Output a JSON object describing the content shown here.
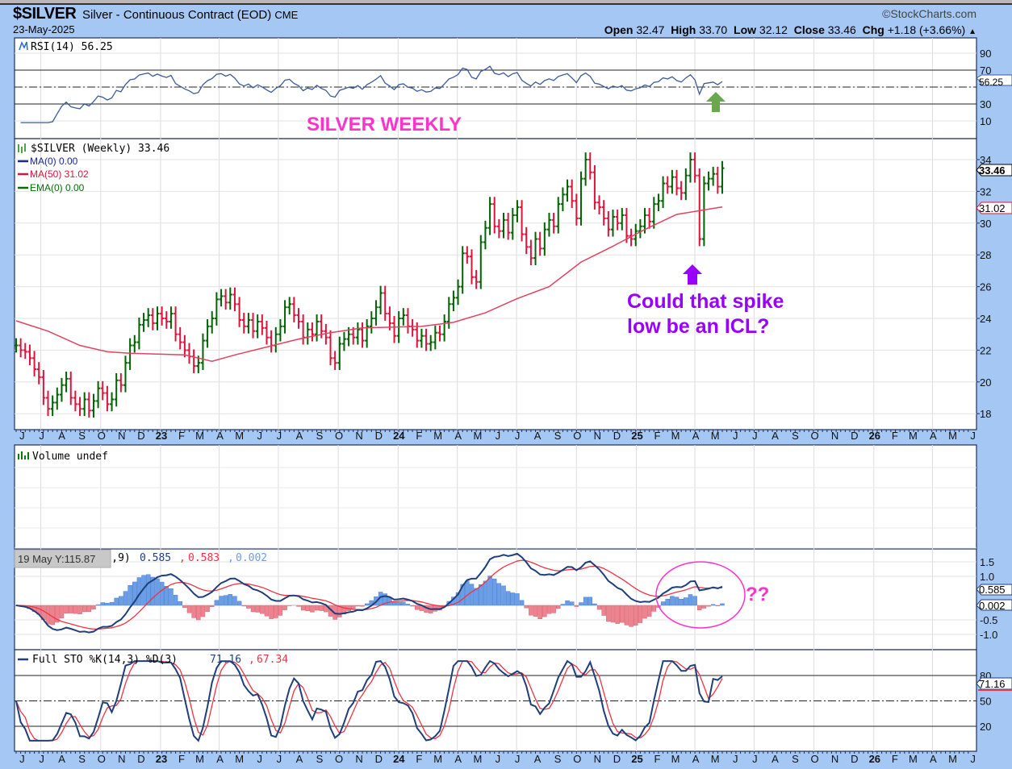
{
  "header": {
    "symbol": "$SILVER",
    "description": "Silver - Continuous Contract (EOD)",
    "exchange": "CME",
    "date": "23-May-2025",
    "brand": "©StockCharts.com",
    "open_label": "Open",
    "open": "32.47",
    "high_label": "High",
    "high": "33.70",
    "low_label": "Low",
    "low": "32.12",
    "close_label": "Close",
    "close": "33.46",
    "chg_label": "Chg",
    "chg": "+1.18 (+3.66%)",
    "chg_arrow": "▲"
  },
  "annotations": {
    "title": "SILVER WEEKLY",
    "spike_line1": "Could that spike",
    "spike_line2": "low be an ICL?",
    "question": "??",
    "tooltip": "19 May Y:115.87",
    "colors": {
      "magenta": "#ff33cc",
      "purple": "#9900ff",
      "green_arrow": "#6aa84f"
    }
  },
  "chart_data": [
    {
      "type": "bar",
      "panel": "price",
      "legend": "$SILVER (Weekly) 33.46",
      "ma_labels": {
        "ma0": "MA(0) 0.00",
        "ma50": "MA(50) 31.02",
        "ema0": "EMA(0) 0.00"
      },
      "last_date": "2025-05-23",
      "interval": "weekly",
      "close": [
        22.3,
        22.0,
        21.9,
        21.5,
        20.8,
        20.3,
        19.0,
        18.3,
        18.7,
        19.2,
        19.8,
        20.2,
        19.0,
        18.6,
        18.3,
        18.9,
        18.2,
        18.8,
        19.6,
        19.3,
        18.6,
        18.9,
        20.1,
        19.8,
        21.2,
        22.3,
        22.5,
        23.6,
        23.9,
        24.2,
        23.7,
        24.3,
        24.0,
        23.8,
        24.3,
        23.0,
        22.5,
        22.0,
        21.6,
        21.0,
        21.2,
        22.6,
        23.5,
        24.0,
        25.2,
        25.4,
        25.0,
        25.5,
        24.9,
        23.9,
        23.5,
        23.9,
        23.2,
        23.8,
        23.4,
        22.8,
        22.3,
        23.0,
        23.5,
        24.7,
        24.9,
        24.2,
        23.8,
        22.8,
        23.3,
        23.0,
        23.8,
        23.2,
        22.8,
        21.5,
        21.2,
        22.4,
        22.7,
        23.0,
        22.8,
        23.3,
        22.6,
        23.5,
        24.0,
        24.7,
        25.6,
        24.3,
        23.7,
        22.9,
        24.0,
        24.2,
        23.5,
        23.3,
        22.6,
        22.9,
        22.4,
        22.5,
        23.1,
        23.0,
        23.8,
        24.9,
        25.3,
        26.0,
        28.1,
        27.9,
        26.6,
        26.3,
        28.8,
        29.7,
        31.2,
        29.8,
        29.5,
        30.2,
        29.4,
        30.5,
        31.0,
        29.3,
        28.5,
        27.8,
        29.0,
        28.4,
        29.6,
        30.2,
        29.8,
        31.2,
        31.8,
        32.3,
        31.4,
        30.3,
        32.8,
        34.0,
        33.2,
        31.3,
        31.0,
        30.3,
        29.6,
        30.4,
        30.0,
        30.5,
        29.2,
        29.0,
        29.5,
        29.8,
        30.5,
        30.1,
        31.2,
        31.4,
        32.5,
        32.3,
        32.9,
        32.2,
        31.9,
        33.0,
        34.0,
        33.0,
        29.0,
        32.5,
        32.8,
        33.1,
        32.3,
        33.46
      ],
      "ma50": [
        [
          "2022-06-03",
          23.85
        ],
        [
          "2022-07-22",
          23.2
        ],
        [
          "2022-09-09",
          22.3
        ],
        [
          "2022-10-21",
          21.9
        ],
        [
          "2022-11-25",
          21.8
        ],
        [
          "2023-02-17",
          21.7
        ],
        [
          "2023-03-31",
          21.3
        ],
        [
          "2023-05-05",
          21.7
        ],
        [
          "2023-06-23",
          22.2
        ],
        [
          "2023-08-11",
          22.7
        ],
        [
          "2023-09-29",
          23.1
        ],
        [
          "2023-11-17",
          23.4
        ],
        [
          "2024-02-16",
          23.5
        ],
        [
          "2024-04-05",
          23.75
        ],
        [
          "2024-05-24",
          24.35
        ],
        [
          "2024-07-12",
          25.25
        ],
        [
          "2024-08-30",
          26.0
        ],
        [
          "2024-10-18",
          27.55
        ],
        [
          "2024-12-06",
          28.55
        ],
        [
          "2025-01-24",
          29.6
        ],
        [
          "2025-03-14",
          30.55
        ],
        [
          "2025-05-23",
          31.02
        ]
      ],
      "y_ticks": [
        "34",
        "32",
        "30",
        "28",
        "26",
        "24",
        "22",
        "20",
        "18"
      ],
      "ylim": [
        17,
        35.5
      ],
      "tags": {
        "close": "33.46",
        "ma50": "31.02"
      },
      "colors": {
        "up": "#006400",
        "down": "#dc143c",
        "ma50": "#e0435f"
      }
    },
    {
      "type": "line",
      "panel": "rsi",
      "legend": "RSI(14) 56.25",
      "y_ticks": [
        "90",
        "70",
        "50",
        "30",
        "10"
      ],
      "levels": [
        70,
        50,
        30
      ],
      "tag": "56.25",
      "color": "#3b5b9a"
    },
    {
      "type": "bar",
      "panel": "volume",
      "legend": "Volume undef"
    },
    {
      "type": "line",
      "panel": "macd",
      "legend_prefix": "MACD(12,26,9)",
      "values": {
        "macd": "0.585",
        "signal": "0.583",
        "hist": "0.002"
      },
      "y_ticks": [
        "1.5",
        "1.0",
        "-0.5",
        "-1.0"
      ],
      "tags": {
        "macd": "0.585",
        "hist": "0.002"
      },
      "colors": {
        "macd": "#1f3f7a",
        "signal": "#ee3344",
        "hist_pos": "#6a9ee8",
        "hist_neg": "#ee8390"
      }
    },
    {
      "type": "line",
      "panel": "sto",
      "legend": "Full STO %K(14,3) %D(3)",
      "values": {
        "k": "71.16",
        "d": "67.34"
      },
      "y_ticks": [
        "80",
        "50",
        "20"
      ],
      "levels": [
        80,
        50,
        20
      ],
      "tag": "71.16"
    }
  ],
  "x_axis": {
    "labels": [
      "J",
      "J",
      "A",
      "S",
      "O",
      "N",
      "D",
      "23",
      "F",
      "M",
      "A",
      "M",
      "J",
      "J",
      "A",
      "S",
      "O",
      "N",
      "D",
      "24",
      "F",
      "M",
      "A",
      "M",
      "J",
      "J",
      "A",
      "S",
      "O",
      "N",
      "D",
      "25",
      "F",
      "M",
      "A",
      "M",
      "J",
      "J",
      "A",
      "S",
      "O",
      "N",
      "D",
      "26",
      "F",
      "M",
      "A",
      "M",
      "J"
    ]
  }
}
